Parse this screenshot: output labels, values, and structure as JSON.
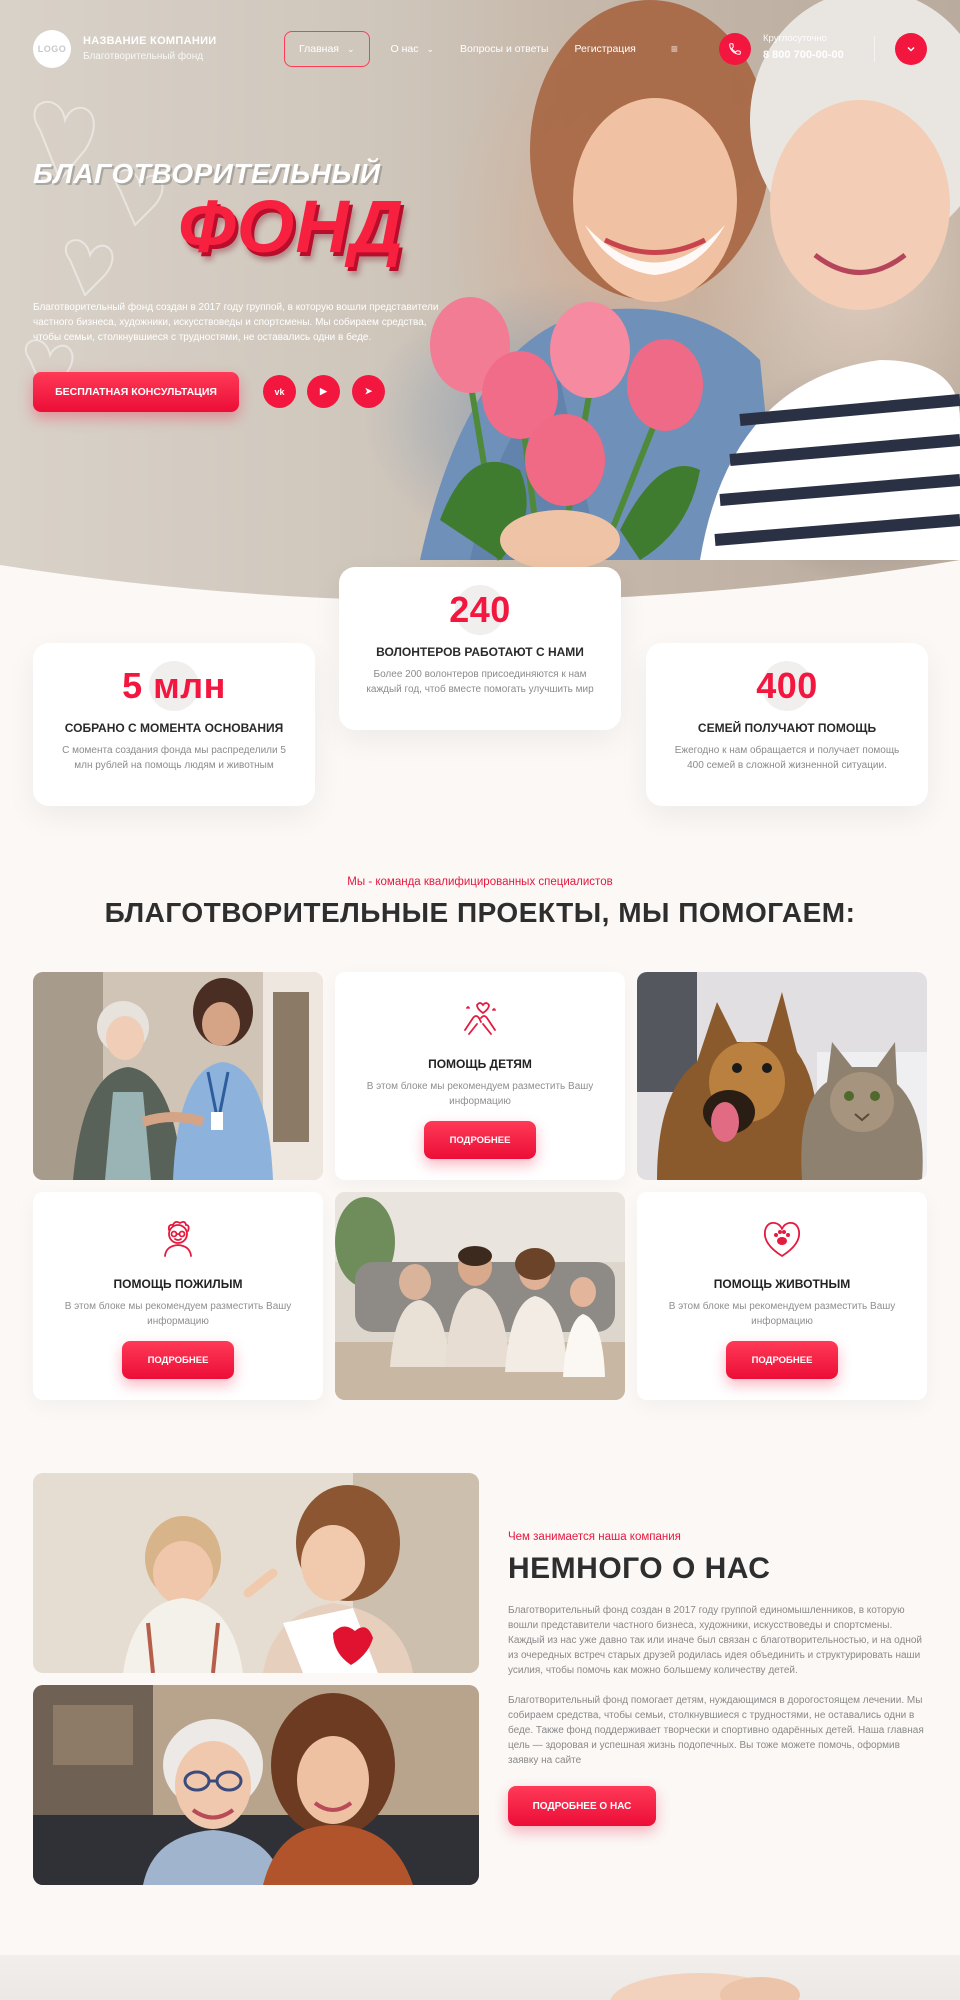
{
  "colors": {
    "accent": "#f3163f",
    "accent_dark": "#b80d2b",
    "text": "#2e2e2e",
    "muted": "#8b8b8b",
    "background": "#fbf8f6"
  },
  "header": {
    "logo_text": "LOGO",
    "company_name": "НАЗВАНИЕ КОМПАНИИ",
    "company_subtitle": "Благотворительный фонд",
    "nav": [
      {
        "label": "Главная",
        "has_dropdown": true,
        "active": true
      },
      {
        "label": "О нас",
        "has_dropdown": true,
        "active": false
      },
      {
        "label": "Вопросы и ответы",
        "has_dropdown": false,
        "active": false
      },
      {
        "label": "Регистрация",
        "has_dropdown": false,
        "active": false
      }
    ],
    "burger_icon": "menu-icon",
    "phone_caption": "Круглосуточно",
    "phone_number": "8 800 700-00-00",
    "phone_icon": "phone-icon",
    "dropdown_icon": "chevron-down-icon"
  },
  "hero": {
    "title_line1": "БЛАГОТВОРИТЕЛЬНЫЙ",
    "title_line2": "ФОНД",
    "description": "Благотворительный фонд создан в 2017 году группой, в которую вошли представители частного бизнеса, художники, искусствоведы и спортсмены. Мы собираем средства, чтобы семьи, столкнувшиеся с трудностями, не оставались одни в беде.",
    "cta_label": "БЕСПЛАТНАЯ КОНСУЛЬТАЦИЯ",
    "socials": [
      {
        "icon": "vk-icon",
        "label": "vk"
      },
      {
        "icon": "youtube-icon",
        "label": "▶"
      },
      {
        "icon": "telegram-icon",
        "label": "➤"
      }
    ]
  },
  "stats": [
    {
      "value": "5 млн",
      "title": "СОБРАНО С МОМЕНТА ОСНОВАНИЯ",
      "text": "С момента создания фонда мы распределили 5 млн рублей на помощь людям и животным"
    },
    {
      "value": "240",
      "title": "ВОЛОНТЕРОВ РАБОТАЮТ С НАМИ",
      "text": "Более 200 волонтеров присоединяются к нам каждый год, чтоб вместе помогать улучшить мир"
    },
    {
      "value": "400",
      "title": "СЕМЕЙ ПОЛУЧАЮТ ПОМОЩЬ",
      "text": "Ежегодно к нам обращается и получает помощь 400 семей в сложной жизненной ситуации."
    }
  ],
  "projects": {
    "subtitle": "Мы - команда квалифицированных специалистов",
    "title": "БЛАГОТВОРИТЕЛЬНЫЕ ПРОЕКТЫ, МЫ ПОМОГАЕМ:",
    "cards": [
      {
        "icon": "children-hands-icon",
        "title": "ПОМОЩЬ ДЕТЯМ",
        "text": "В этом блоке мы рекомендуем разместить Вашу информацию",
        "button": "ПОДРОБНЕЕ"
      },
      {
        "icon": "elderly-icon",
        "title": "ПОМОЩЬ ПОЖИЛЫМ",
        "text": "В этом блоке мы рекомендуем разместить Вашу информацию",
        "button": "ПОДРОБНЕЕ"
      },
      {
        "icon": "paw-heart-icon",
        "title": "ПОМОЩЬ ЖИВОТНЫМ",
        "text": "В этом блоке мы рекомендуем разместить Вашу информацию",
        "button": "ПОДРОБНЕЕ"
      }
    ]
  },
  "about": {
    "subtitle": "Чем занимается наша компания",
    "title": "НЕМНОГО О НАС",
    "paragraph1": "Благотворительный фонд создан в 2017 году группой единомышленников, в которую вошли представители частного бизнеса, художники, искусствоведы и спортсмены. Каждый из нас уже давно так или иначе был связан с благотворительностью, и на одной из очередных встреч старых друзей родилась идея объединить и структурировать наши усилия, чтобы помочь как можно большему количеству детей.",
    "paragraph2": "Благотворительный фонд помогает детям, нуждающимся в дорогостоящем лечении. Мы собираем средства, чтобы семьи, столкнувшиеся с трудностями, не оставались одни в беде. Также фонд поддерживает творчески и спортивно одарённых детей. Наша главная цель — здоровая и успешная жизнь подопечных. Вы тоже можете помочь, оформив заявку на сайте",
    "button": "ПОДРОБНЕЕ О НАС"
  }
}
